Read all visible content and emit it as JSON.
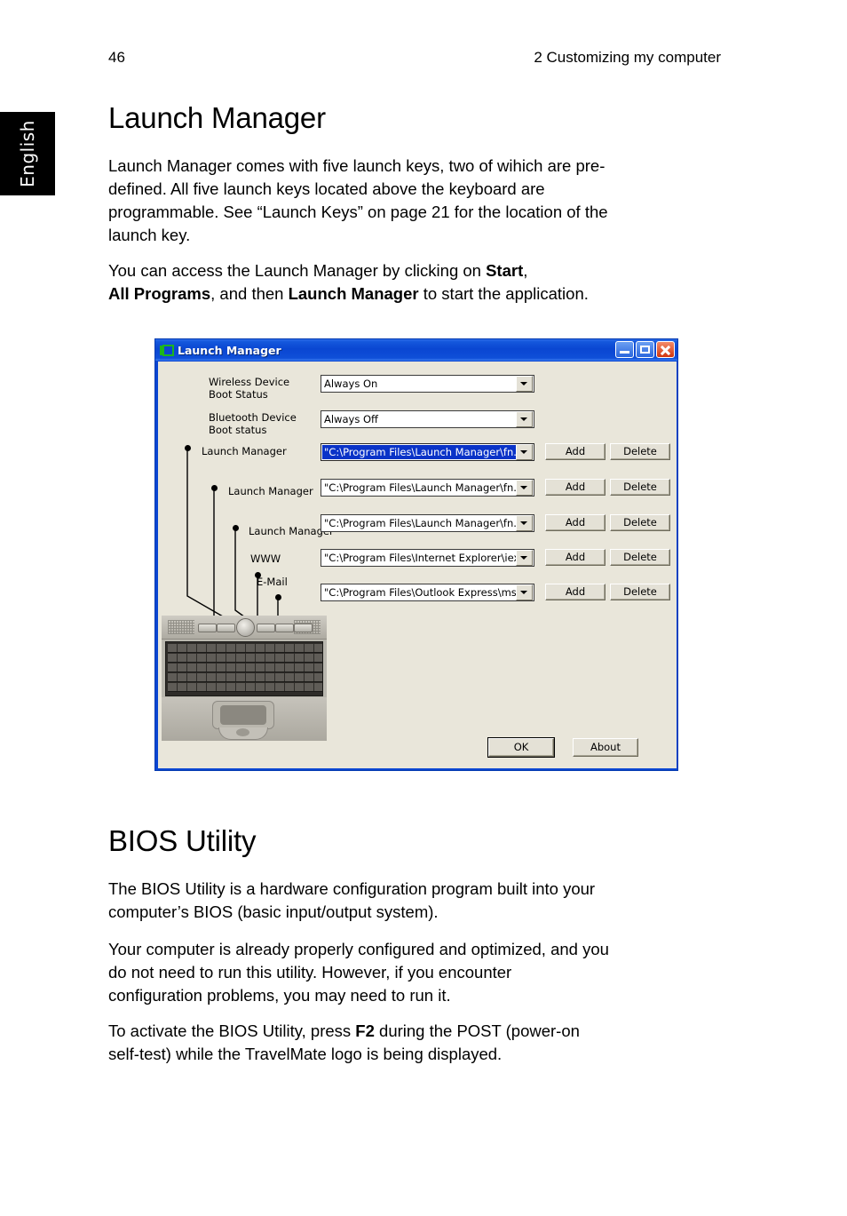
{
  "page": {
    "folio": "46",
    "chapter_header": "2 Customizing my computer",
    "language_tab": "English"
  },
  "sections": [
    {
      "title": "Launch Manager",
      "paragraphs": [
        "Launch Manager comes with five launch keys, two of wihich are pre-defined. All five launch keys located above the keyboard are programmable. See “Launch Keys” on page 21 for the location of the launch key.",
        "You can access the Launch Manager by clicking on Start, All Programs, and then Launch Manager to start the application."
      ]
    },
    {
      "title": "BIOS Utility",
      "paragraphs": [
        "The BIOS Utility is a hardware configuration program built into your computer’s BIOS (basic input/output system).",
        "Your computer is already properly configured and optimized, and you do not need to run this utility. However, if you encounter configuration problems, you may need to run it.",
        "To activate the BIOS Utility, press F2 during the POST (power-on self-test) while the TravelMate logo is being displayed."
      ]
    }
  ],
  "text_runs": {
    "lm_para1_a": "Launch Manager comes with five launch keys, two of wihich are pre-",
    "lm_para1_b": "defined. All five launch keys located above the keyboard are",
    "lm_para1_c": "programmable. See “Launch Keys” on page 21 for the location of the",
    "lm_para1_d": "launch key.",
    "lm_para2_a": "You can access the Launch Manager by clicking on ",
    "lm_para2_start": "Start",
    "lm_para2_b": ",",
    "lm_para2_allprograms": "All Programs",
    "lm_para2_c": ", and then ",
    "lm_para2_lm": "Launch Manager",
    "lm_para2_d": " to start the application.",
    "bios_para1_a": "The BIOS Utility is a hardware configuration program built into your",
    "bios_para1_b": "computer’s BIOS (basic input/output system).",
    "bios_para2_a": "Your computer is already properly configured and optimized, and you",
    "bios_para2_b": "do not need to run this utility. However, if you encounter",
    "bios_para2_c": "configuration problems, you may need to run it.",
    "bios_para3_a": "To activate the BIOS Utility, press ",
    "bios_para3_f2": "F2",
    "bios_para3_b": " during the POST (power-on",
    "bios_para3_c": "self-test) while the TravelMate logo is being displayed."
  },
  "dialog": {
    "title": "Launch Manager",
    "icon": "launch-manager-icon",
    "caption_buttons": [
      {
        "name": "minimize",
        "glyph": "_"
      },
      {
        "name": "maximize",
        "glyph": "□"
      },
      {
        "name": "close",
        "glyph": "×"
      }
    ],
    "boot_settings": [
      {
        "label_line1": "Wireless Device",
        "label_line2": "Boot Status",
        "value": "Always On"
      },
      {
        "label_line1": "Bluetooth Device",
        "label_line2": "Boot status",
        "value": "Always Off"
      }
    ],
    "key_rows": [
      {
        "label": "Launch Manager",
        "value": "\"C:\\Program Files\\Launch Manager\\fn.exe\"",
        "selected": true,
        "add_label": "Add",
        "delete_label": "Delete"
      },
      {
        "label": "Launch Manager",
        "value": "\"C:\\Program Files\\Launch Manager\\fn.exe\"",
        "selected": false,
        "add_label": "Add",
        "delete_label": "Delete"
      },
      {
        "label": "Launch Manager",
        "value": "\"C:\\Program Files\\Launch Manager\\fn.exe\"",
        "selected": false,
        "add_label": "Add",
        "delete_label": "Delete"
      },
      {
        "label": "WWW",
        "value": "\"C:\\Program Files\\Internet Explorer\\iexplore.e",
        "selected": false,
        "add_label": "Add",
        "delete_label": "Delete"
      },
      {
        "label": "E-Mail",
        "value": "\"C:\\Program Files\\Outlook Express\\msimn.ex",
        "selected": false,
        "add_label": "Add",
        "delete_label": "Delete"
      }
    ],
    "footer_buttons": {
      "ok": "OK",
      "about": "About"
    },
    "colors": {
      "titlebar": "#0a46d2",
      "client": "#e9e6da",
      "selection": "#0a33c8",
      "close_button": "#d2360f"
    }
  }
}
